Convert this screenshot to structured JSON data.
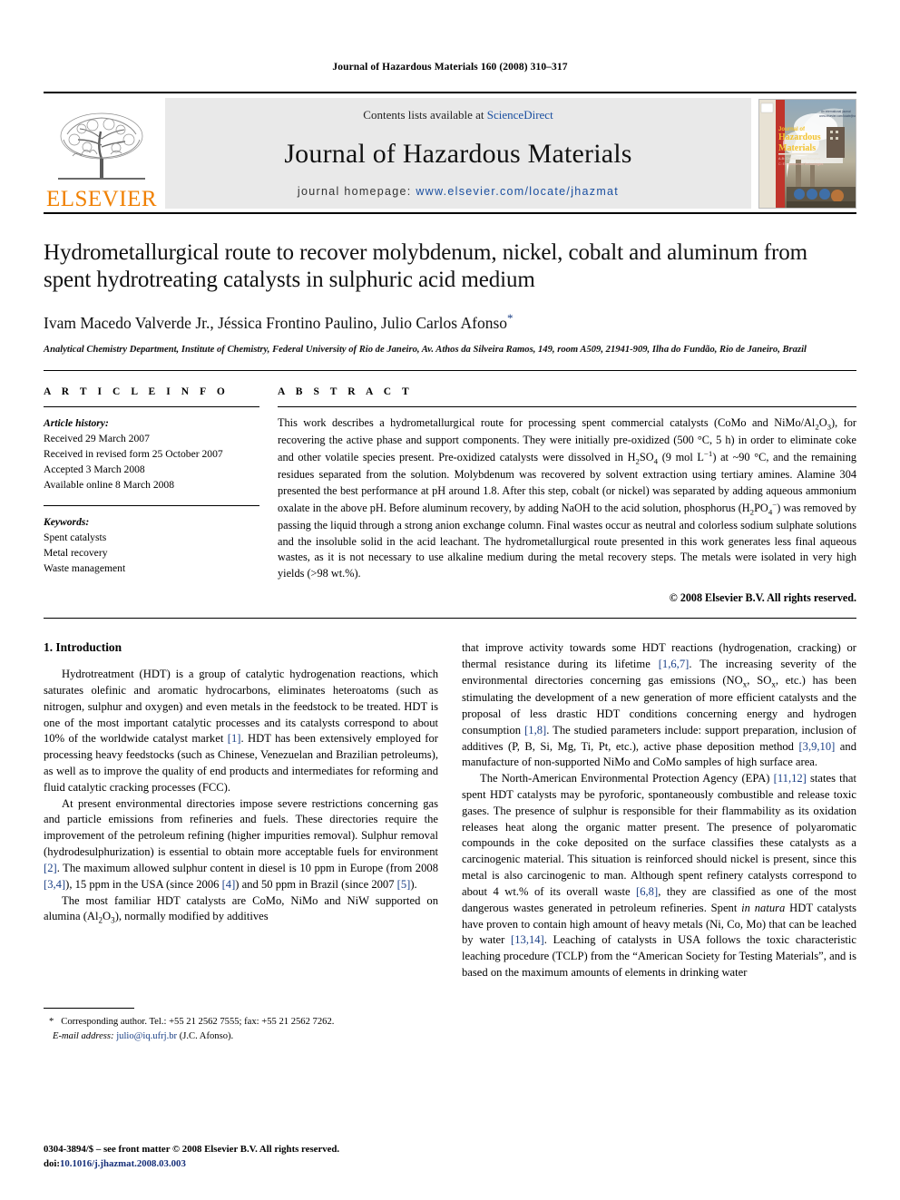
{
  "running_head": "Journal of Hazardous Materials 160 (2008) 310–317",
  "masthead": {
    "publisher_name": "ELSEVIER",
    "contents_prefix": "Contents lists available at ",
    "sciencedirect": "ScienceDirect",
    "journal_title": "Journal of Hazardous Materials",
    "homepage_prefix": "journal homepage:",
    "homepage_url": "www.elsevier.com/locate/jhazmat",
    "cover_title_line1": "Journal of",
    "cover_title_line2": "Hazardous",
    "cover_title_line3": "Materials",
    "cover_sub1": "A-B: Chemical and Biological",
    "cover_sub2": "C: Environmental Technologies"
  },
  "article": {
    "title": "Hydrometallurgical route to recover molybdenum, nickel, cobalt and aluminum from spent hydrotreating catalysts in sulphuric acid medium",
    "authors": "Ivam Macedo Valverde Jr., Jéssica Frontino Paulino, Julio Carlos Afonso",
    "corresponding_marker": "*",
    "affiliation": "Analytical Chemistry Department, Institute of Chemistry, Federal University of Rio de Janeiro, Av. Athos da Silveira Ramos, 149, room A509, 21941-909, Ilha do Fundão, Rio de Janeiro, Brazil"
  },
  "article_info": {
    "heading": "A R T I C L E   I N F O",
    "history_label": "Article history:",
    "history": [
      "Received 29 March 2007",
      "Received in revised form 25 October 2007",
      "Accepted 3 March 2008",
      "Available online 8 March 2008"
    ],
    "keywords_label": "Keywords:",
    "keywords": [
      "Spent catalysts",
      "Metal recovery",
      "Waste management"
    ]
  },
  "abstract": {
    "heading": "A B S T R A C T",
    "copyright": "© 2008 Elsevier B.V. All rights reserved."
  },
  "sections": {
    "intro_heading": "1.  Introduction"
  },
  "footnote": {
    "marker": "*",
    "corresponding": "Corresponding author. Tel.: +55 21 2562 7555; fax: +55 21 2562 7262.",
    "email_label": "E-mail address:",
    "email": "julio@iq.ufrj.br",
    "email_owner": "(J.C. Afonso)."
  },
  "page_footer": {
    "issn_line": "0304-3894/$ – see front matter © 2008 Elsevier B.V. All rights reserved.",
    "doi_label": "doi:",
    "doi": "10.1016/j.jhazmat.2008.03.003"
  },
  "colors": {
    "elsevier_orange": "#F08000",
    "link_blue": "#1a4fa0",
    "ref_blue": "#1a3f86",
    "band_grey": "#e9e9e9"
  }
}
